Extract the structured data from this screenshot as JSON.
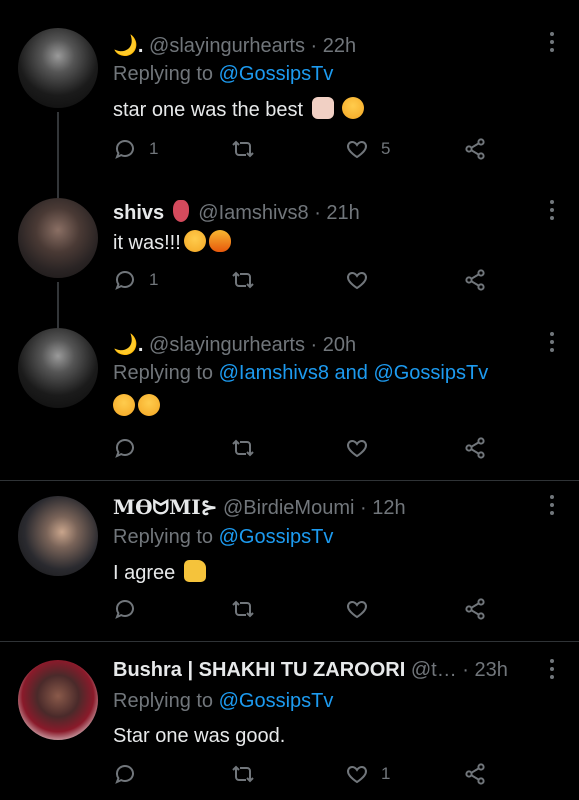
{
  "tweets": [
    {
      "name": "🌙.",
      "handle": "@slayingurhearts",
      "time": "· 22h",
      "replying_label": "Replying to",
      "replying_to": "@GossipsTv",
      "text": "star one was the best",
      "replies": "1",
      "retweets": "",
      "likes": "5"
    },
    {
      "name": "shivs",
      "handle": "@Iamshivs8",
      "time": "· 21h",
      "text": "it was!!!",
      "replies": "1",
      "retweets": "",
      "likes": ""
    },
    {
      "name": "🌙.",
      "handle": "@slayingurhearts",
      "time": "· 20h",
      "replying_label": "Replying to",
      "replying_to": "@Iamshivs8 and @GossipsTv",
      "text": "",
      "replies": "",
      "retweets": "",
      "likes": ""
    },
    {
      "name": "MӨᗢMI⊱",
      "handle": "@BirdieMoumi",
      "time": "· 12h",
      "replying_label": "Replying to",
      "replying_to": "@GossipsTv",
      "text": "I agree",
      "replies": "",
      "retweets": "",
      "likes": ""
    },
    {
      "name": "Bushra | SHAKHI TU ZAROORI",
      "handle": "@t…",
      "time": "· 23h",
      "replying_label": "Replying to",
      "replying_to": "@GossipsTv",
      "text": "Star one was good.",
      "replies": "",
      "retweets": "",
      "likes": "1"
    }
  ],
  "colors": {
    "background": "#000000",
    "text": "#e7e9ea",
    "muted": "#71767b",
    "link": "#1d9bf0"
  },
  "icons": {
    "reply": "reply-icon",
    "retweet": "retweet-icon",
    "like": "heart-icon",
    "share": "share-icon",
    "more": "more-icon"
  }
}
